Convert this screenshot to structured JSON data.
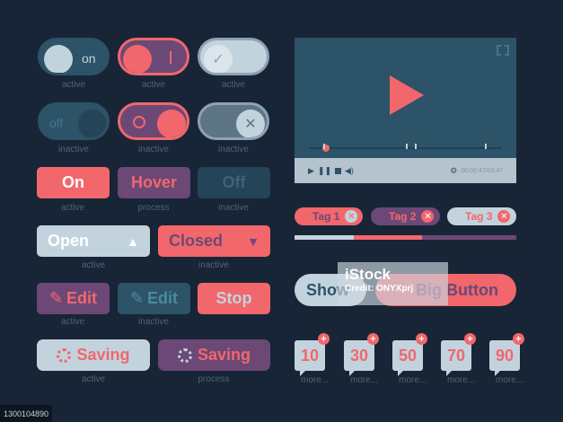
{
  "colors": {
    "background": "#182536",
    "coral": "#f1676c",
    "slate": "#c3d3dd",
    "purple": "#6c4876",
    "teal": "#2c5367",
    "caption": "#4c6478"
  },
  "toggles": [
    {
      "label": "on",
      "caption": "active"
    },
    {
      "label": "",
      "caption": "active"
    },
    {
      "label": "",
      "caption": "active"
    },
    {
      "label": "off",
      "caption": "inactive"
    },
    {
      "label": "",
      "caption": "inactive"
    },
    {
      "label": "",
      "caption": "inactive"
    }
  ],
  "state_buttons": [
    {
      "label": "On",
      "caption": "active"
    },
    {
      "label": "Hover",
      "caption": "process"
    },
    {
      "label": "Off",
      "caption": "inactive"
    }
  ],
  "dropdowns": [
    {
      "label": "Open",
      "caption": "active"
    },
    {
      "label": "Closed",
      "caption": "inactive"
    }
  ],
  "action_buttons": [
    {
      "label": "Edit",
      "caption": "active"
    },
    {
      "label": "Edit",
      "caption": "inactive"
    },
    {
      "label": "Stop",
      "caption": ""
    }
  ],
  "saving_buttons": [
    {
      "label": "Saving",
      "caption": "active"
    },
    {
      "label": "Saving",
      "caption": "process"
    }
  ],
  "video": {
    "time": "00:00:47/03:47",
    "progress_fraction": 0.09
  },
  "tags": [
    {
      "label": "Tag 1"
    },
    {
      "label": "Tag 2"
    },
    {
      "label": "Tag 3"
    }
  ],
  "show_button": {
    "label": "Show"
  },
  "big_button": {
    "label": "Big Button"
  },
  "watermark": {
    "title": "iStock",
    "credit": "Credit: ONYXprj"
  },
  "badges": [
    {
      "value": "10",
      "more": "more..."
    },
    {
      "value": "30",
      "more": "more..."
    },
    {
      "value": "50",
      "more": "more..."
    },
    {
      "value": "70",
      "more": "more..."
    },
    {
      "value": "90",
      "more": "more..."
    }
  ],
  "stock_id": "1300104890"
}
